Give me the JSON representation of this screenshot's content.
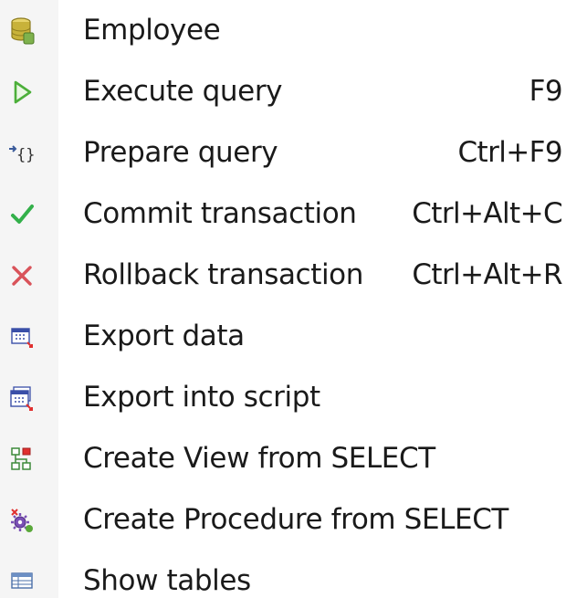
{
  "menu": {
    "items": [
      {
        "label": "Employee",
        "shortcut": "",
        "icon": "database-icon"
      },
      {
        "label": "Execute query",
        "shortcut": "F9",
        "icon": "play-icon"
      },
      {
        "label": "Prepare query",
        "shortcut": "Ctrl+F9",
        "icon": "prepare-query-icon"
      },
      {
        "label": "Commit transaction",
        "shortcut": "Ctrl+Alt+C",
        "icon": "checkmark-icon"
      },
      {
        "label": "Rollback transaction",
        "shortcut": "Ctrl+Alt+R",
        "icon": "cross-icon"
      },
      {
        "label": "Export data",
        "shortcut": "",
        "icon": "export-data-icon"
      },
      {
        "label": "Export into script",
        "shortcut": "",
        "icon": "export-script-icon"
      },
      {
        "label": "Create View from SELECT",
        "shortcut": "",
        "icon": "create-view-icon"
      },
      {
        "label": "Create Procedure from SELECT",
        "shortcut": "",
        "icon": "create-procedure-icon"
      },
      {
        "label": "Show tables",
        "shortcut": "",
        "icon": "show-tables-icon"
      }
    ]
  },
  "colors": {
    "play": "#4caf3a",
    "check": "#33b04a",
    "cross": "#d9535a",
    "database": "#c8b23a"
  }
}
